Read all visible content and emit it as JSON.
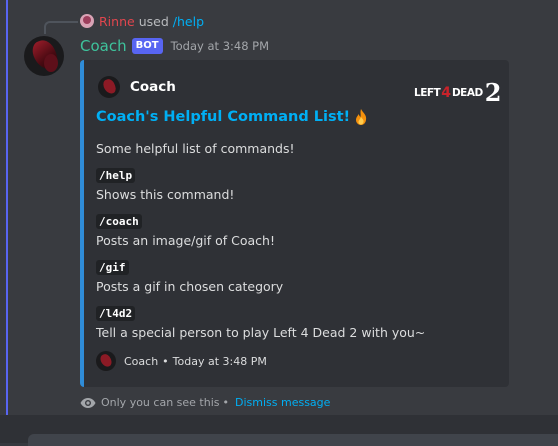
{
  "reply": {
    "user": "Rinne",
    "used_text": "used",
    "command": "/help"
  },
  "message": {
    "author": "Coach",
    "bot_tag": "BOT",
    "timestamp": "Today at 3:48 PM"
  },
  "embed": {
    "author_name": "Coach",
    "logo": {
      "left": "LEFT",
      "four": "4",
      "dead": "DEAD",
      "two": "2"
    },
    "title": "Coach's Helpful Command List!",
    "description": "Some helpful list of commands!",
    "commands": [
      {
        "name": "/help",
        "desc": "Shows this command!"
      },
      {
        "name": "/coach",
        "desc": "Posts an image/gif of Coach!"
      },
      {
        "name": "/gif",
        "desc": "Posts a gif in chosen category"
      },
      {
        "name": "/l4d2",
        "desc": "Tell a special person to play Left 4 Dead 2 with you~"
      }
    ],
    "footer_name": "Coach",
    "footer_sep": "•",
    "footer_time": "Today at 3:48 PM",
    "accent_color": "#2f8cd8"
  },
  "ephemeral": {
    "notice": "Only you can see this",
    "sep": "•",
    "dismiss": "Dismiss message"
  }
}
